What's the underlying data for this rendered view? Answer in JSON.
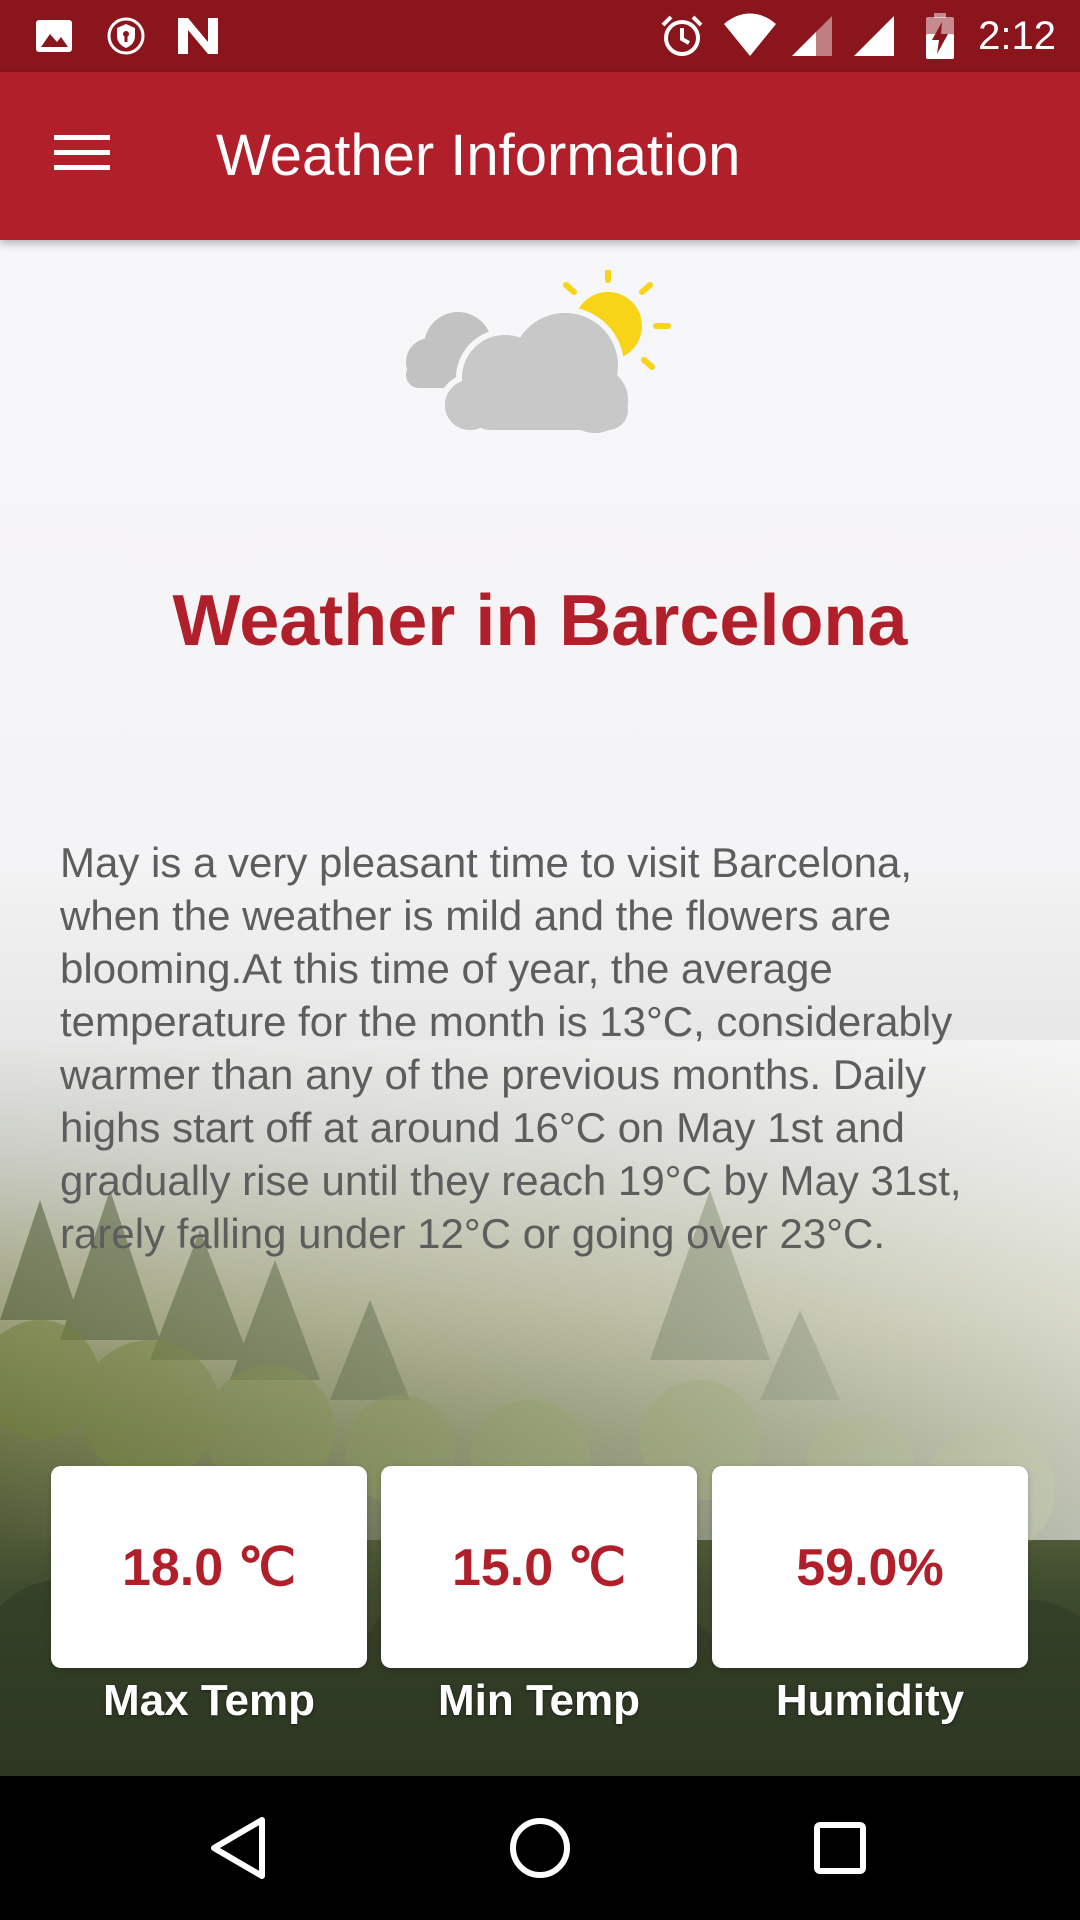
{
  "status_bar": {
    "time": "2:12",
    "icons": [
      "image-notification-icon",
      "vpn-shield-icon",
      "n-notification-icon",
      "alarm-icon",
      "wifi-icon",
      "signal-icon",
      "signal-icon",
      "battery-charging-icon"
    ]
  },
  "app_bar": {
    "title": "Weather Information",
    "menu_icon": "hamburger-menu-icon"
  },
  "main": {
    "weather_icon": "partly-cloudy-icon",
    "city_title": "Weather in Barcelona",
    "description": "May is a very pleasant time to visit Barcelona, when the weather is mild and the flowers are blooming.At this time of year, the average temperature for the month is 13°C, considerably warmer than any of the previous months. Daily highs start off at around 16°C on May 1st and gradually rise until they reach 19°C by May 31st, rarely falling under 12°C or going over 23°C.",
    "stats": [
      {
        "value": "18.0 ℃",
        "label": "Max Temp"
      },
      {
        "value": "15.0 ℃",
        "label": "Min Temp"
      },
      {
        "value": "59.0%",
        "label": "Humidity"
      }
    ]
  },
  "nav_bar": {
    "buttons": [
      "back-icon",
      "home-icon",
      "recents-icon"
    ]
  },
  "colors": {
    "status_bar": "#8b151c",
    "app_bar": "#b01f2a",
    "accent_text": "#b01f2a",
    "body_text": "#5d5d5d",
    "sun": "#f7d417",
    "cloud": "#c2c2c2"
  }
}
